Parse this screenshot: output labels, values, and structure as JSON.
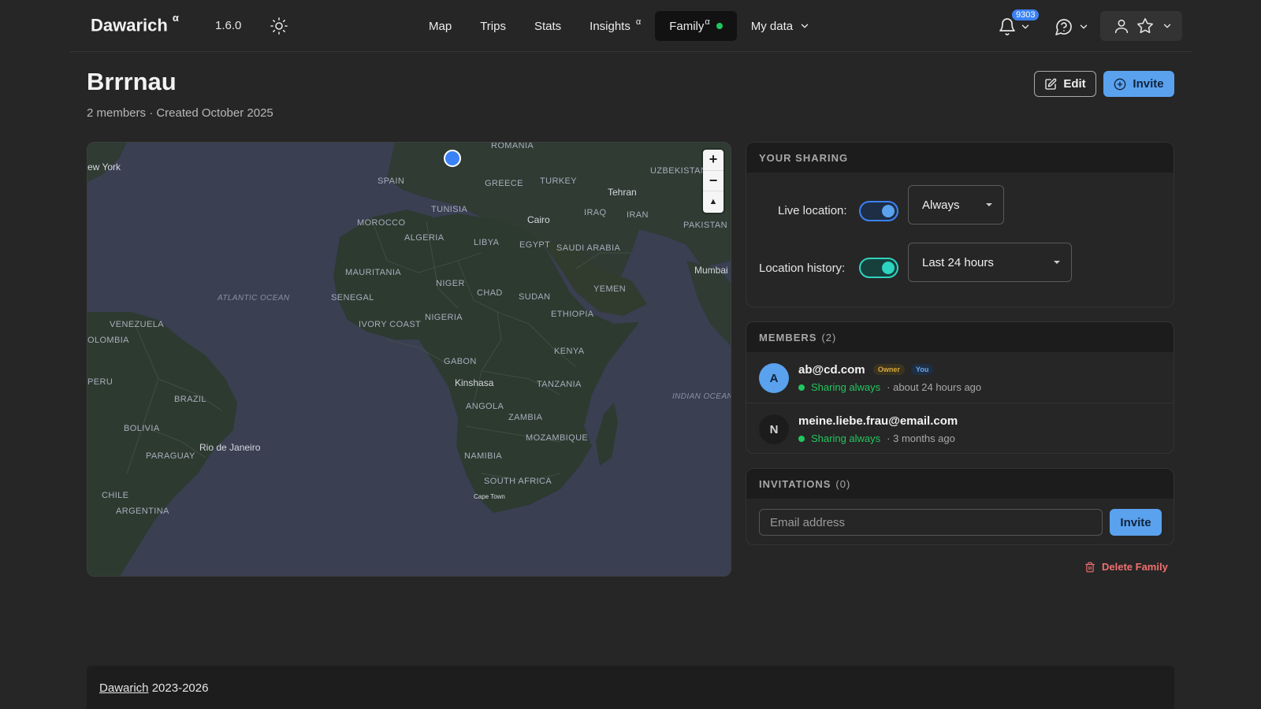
{
  "navbar": {
    "brand": "Dawarich",
    "brand_sup": "α",
    "version": "1.6.0",
    "links": [
      {
        "label": "Map",
        "sup": ""
      },
      {
        "label": "Trips",
        "sup": ""
      },
      {
        "label": "Stats",
        "sup": ""
      },
      {
        "label": "Insights",
        "sup": "α"
      },
      {
        "label": "Family",
        "sup": "α",
        "active": true,
        "status_dot_color": "#22c55e"
      },
      {
        "label": "My data",
        "sup": "",
        "dropdown": true
      }
    ],
    "notification_count": "9303",
    "icons": [
      "sun-icon",
      "bell-icon",
      "help-icon",
      "user-icon",
      "star-icon",
      "chevron-down-icon"
    ]
  },
  "header": {
    "title": "Brrrnau",
    "subtitle": "2 members · Created October 2025",
    "edit_label": "Edit",
    "invite_label": "Invite"
  },
  "map": {
    "labels": {
      "new_york": "ew York",
      "romania": "ROMANIA",
      "uzbekistan": "UZBEKISTAN",
      "spain": "SPAIN",
      "greece": "GREECE",
      "turkey": "TURKEY",
      "tehran": "Tehran",
      "tunisia": "TUNISIA",
      "iraq": "IRAQ",
      "iran": "IRAN",
      "morocco": "MOROCCO",
      "cairo": "Cairo",
      "pakistan": "PAKISTAN",
      "algeria": "ALGERIA",
      "libya": "LIBYA",
      "egypt": "EGYPT",
      "saudi_arabia": "SAUDI ARABIA",
      "mauritania": "MAURITANIA",
      "niger": "NIGER",
      "mumbai": "Mumbai",
      "atlantic": "ATLANTIC OCEAN",
      "chad": "CHAD",
      "sudan": "SUDAN",
      "yemen": "YEMEN",
      "senegal": "SENEGAL",
      "nigeria": "NIGERIA",
      "ethiopia": "ETHIOPIA",
      "ivory_coast": "IVORY COAST",
      "venezuela": "VENEZUELA",
      "colombia": "OLOMBIA",
      "kenya": "KENYA",
      "gabon": "GABON",
      "kinshasa": "Kinshasa",
      "tanzania": "TANZANIA",
      "peru": "PERU",
      "indian": "INDIAN OCEAN",
      "brazil": "BRAZIL",
      "angola": "ANGOLA",
      "zambia": "ZAMBIA",
      "bolivia": "BOLIVIA",
      "rio": "Rio de Janeiro",
      "mozambique": "MOZAMBIQUE",
      "paraguay": "PARAGUAY",
      "namibia": "NAMIBIA",
      "south_africa": "SOUTH AFRICA",
      "chile": "CHILE",
      "cape_town": "Cape Town",
      "argentina": "ARGENTINA"
    },
    "zoom_in": "+",
    "zoom_out": "−",
    "compass": "▲"
  },
  "sharing": {
    "heading": "YOUR SHARING",
    "live_location_label": "Live location:",
    "live_location_value": "Always",
    "live_location_on": true,
    "live_toggle_color": "#3b82f6",
    "history_label": "Location history:",
    "history_value": "Last 24 hours",
    "history_on": true,
    "history_toggle_color": "#2dd4bf"
  },
  "members": {
    "heading": "MEMBERS",
    "count": "(2)",
    "list": [
      {
        "initial": "A",
        "email": "ab@cd.com",
        "owner_badge": "Owner",
        "you_badge": "You",
        "sharing": "Sharing always",
        "last_seen": "· about 24 hours ago",
        "avatar_bg": "#5aa2ee"
      },
      {
        "initial": "N",
        "email": "meine.liebe.frau@email.com",
        "sharing": "Sharing always",
        "last_seen": "· 3 months ago",
        "avatar_bg": "#1c1c1c"
      }
    ]
  },
  "invitations": {
    "heading": "INVITATIONS",
    "count": "(0)",
    "email_placeholder": "Email address",
    "invite_label": "Invite"
  },
  "delete_family_label": "Delete Family",
  "footer": {
    "link": "Dawarich",
    "years": "2023-2026"
  }
}
